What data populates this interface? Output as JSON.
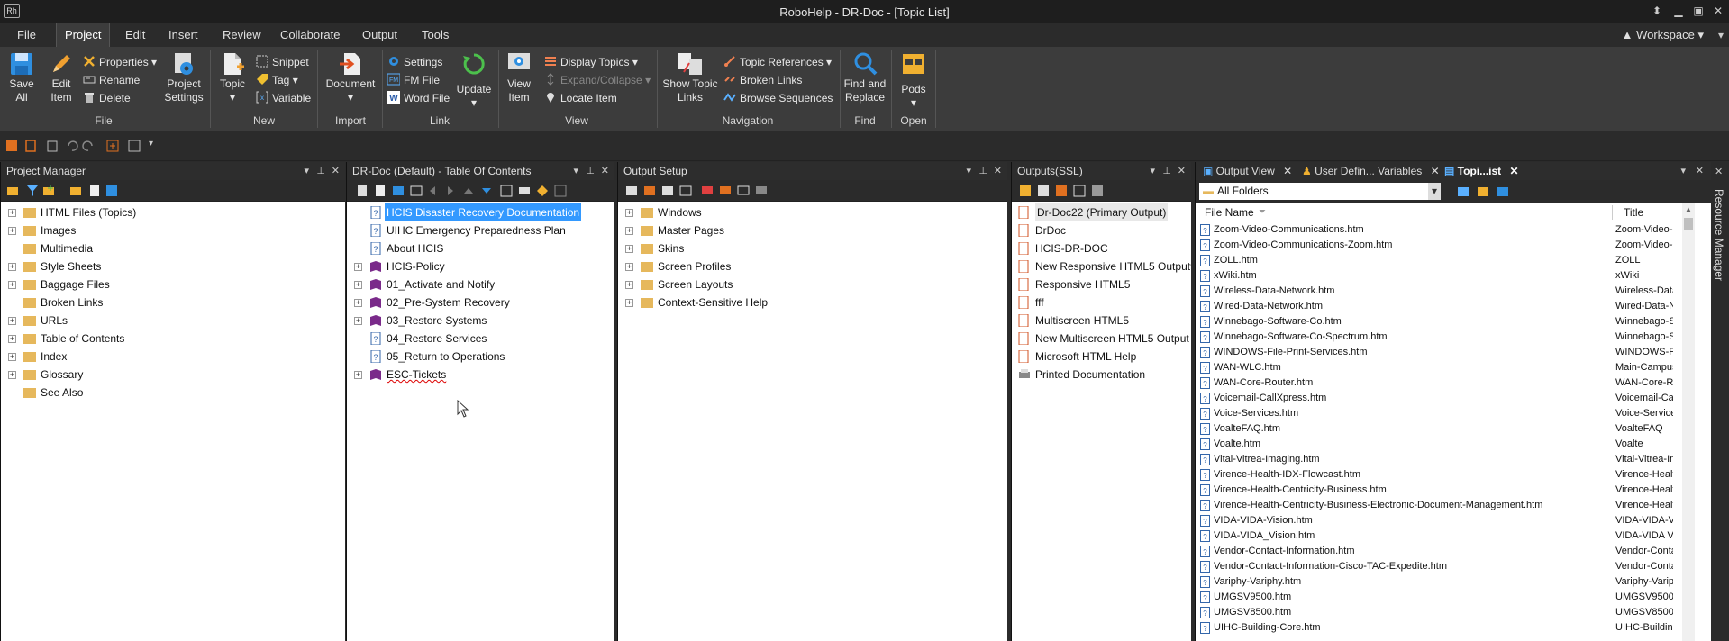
{
  "window": {
    "title": "RoboHelp - DR-Doc - [Topic List]",
    "app_icon": "Rh"
  },
  "menu": {
    "items": [
      "File",
      "Project",
      "Edit",
      "Insert",
      "Review",
      "Collaborate",
      "Output",
      "Tools"
    ],
    "workspace": "Workspace"
  },
  "ribbon": {
    "file_group": {
      "label": "File",
      "save_all": "Save All",
      "edit_item": "Edit Item",
      "properties": "Properties",
      "rename": "Rename",
      "delete": "Delete",
      "project_settings": "Project Settings"
    },
    "new_group": {
      "label": "New",
      "topic": "Topic",
      "snippet": "Snippet",
      "tag": "Tag",
      "variable": "Variable"
    },
    "import_group": {
      "label": "Import",
      "document": "Document"
    },
    "link_group": {
      "label": "Link",
      "settings": "Settings",
      "fm_file": "FM File",
      "word_file": "Word File",
      "update": "Update"
    },
    "view_group": {
      "label": "View",
      "view_item": "View Item",
      "display_topics": "Display Topics",
      "expand_collapse": "Expand/Collapse",
      "locate_item": "Locate Item"
    },
    "navigation_group": {
      "label": "Navigation",
      "show_topic_links": "Show Topic Links",
      "topic_references": "Topic References",
      "broken_links": "Broken Links",
      "browse_sequences": "Browse Sequences"
    },
    "find_group": {
      "label": "Find",
      "find_replace": "Find and Replace"
    },
    "open_group": {
      "label": "Open",
      "pods": "Pods"
    }
  },
  "project_manager": {
    "title": "Project Manager",
    "items": [
      "HTML Files (Topics)",
      "Images",
      "Multimedia",
      "Style Sheets",
      "Baggage Files",
      "Broken Links",
      "URLs",
      "Table of Contents",
      "Index",
      "Glossary",
      "See Also"
    ]
  },
  "toc": {
    "title": "DR-Doc (Default) - Table Of Contents",
    "items": [
      "HCIS Disaster Recovery Documentation",
      "UIHC Emergency Preparedness Plan",
      "About HCIS",
      "HCIS-Policy",
      "01_Activate and Notify",
      "02_Pre-System Recovery",
      "03_Restore Systems",
      "04_Restore Services",
      "05_Return to Operations",
      "ESC-Tickets"
    ]
  },
  "output_setup": {
    "title": "Output Setup",
    "items": [
      "Windows",
      "Master Pages",
      "Skins",
      "Screen Profiles",
      "Screen Layouts",
      "Context-Sensitive Help"
    ]
  },
  "outputs": {
    "title": "Outputs(SSL)",
    "items": [
      "Dr-Doc22 (Primary Output)",
      "DrDoc",
      "HCIS-DR-DOC",
      "New Responsive HTML5 Output99",
      "Responsive HTML5",
      "fff",
      "Multiscreen HTML5",
      "New Multiscreen HTML5 Output",
      "Microsoft HTML Help",
      "Printed Documentation"
    ]
  },
  "topic_list": {
    "tabs": [
      "Output View",
      "User Defin... Variables",
      "Topi...ist"
    ],
    "folder": "All Folders",
    "col_file": "File Name",
    "col_title": "Title",
    "rows": [
      {
        "file": "Zoom-Video-Communications.htm",
        "title": "Zoom-Video-Com"
      },
      {
        "file": "Zoom-Video-Communications-Zoom.htm",
        "title": "Zoom-Video-Com"
      },
      {
        "file": "ZOLL.htm",
        "title": "ZOLL"
      },
      {
        "file": "xWiki.htm",
        "title": "xWiki"
      },
      {
        "file": "Wireless-Data-Network.htm",
        "title": "Wireless-Data-N"
      },
      {
        "file": "Wired-Data-Network.htm",
        "title": "Wired-Data-Netw"
      },
      {
        "file": "Winnebago-Software-Co.htm",
        "title": "Winnebago-Soft"
      },
      {
        "file": "Winnebago-Software-Co-Spectrum.htm",
        "title": "Winnebago-Soft"
      },
      {
        "file": "WINDOWS-File-Print-Services.htm",
        "title": "WINDOWS-File"
      },
      {
        "file": "WAN-WLC.htm",
        "title": "Main-Campus-W"
      },
      {
        "file": "WAN-Core-Router.htm",
        "title": "WAN-Core-Rout"
      },
      {
        "file": "Voicemail-CallXpress.htm",
        "title": "Voicemail-CallXp"
      },
      {
        "file": "Voice-Services.htm",
        "title": "Voice-Services"
      },
      {
        "file": "VoalteFAQ.htm",
        "title": "VoalteFAQ"
      },
      {
        "file": "Voalte.htm",
        "title": "Voalte"
      },
      {
        "file": "Vital-Vitrea-Imaging.htm",
        "title": "Vital-Vitrea-Imag"
      },
      {
        "file": "Virence-Health-IDX-Flowcast.htm",
        "title": "Virence-Health-I"
      },
      {
        "file": "Virence-Health-Centricity-Business.htm",
        "title": "Virence-Health-C"
      },
      {
        "file": "Virence-Health-Centricity-Business-Electronic-Document-Management.htm",
        "title": "Virence-Health-C"
      },
      {
        "file": "VIDA-VIDA-Vision.htm",
        "title": "VIDA-VIDA-Visio"
      },
      {
        "file": "VIDA-VIDA_Vision.htm",
        "title": "VIDA-VIDA Visio"
      },
      {
        "file": "Vendor-Contact-Information.htm",
        "title": "Vendor-Contact-"
      },
      {
        "file": "Vendor-Contact-Information-Cisco-TAC-Expedite.htm",
        "title": "Vendor-Contact-"
      },
      {
        "file": "Variphy-Variphy.htm",
        "title": "Variphy-Variphy"
      },
      {
        "file": "UMGSV9500.htm",
        "title": "UMGSV9500"
      },
      {
        "file": "UMGSV8500.htm",
        "title": "UMGSV8500"
      },
      {
        "file": "UIHC-Building-Core.htm",
        "title": "UIHC-Building-C"
      }
    ]
  },
  "resource_manager": "Resource Manager",
  "colors": {
    "accent": "#3399ff",
    "chrome": "#2b2b2b",
    "ribbon": "#3c3c3c"
  }
}
